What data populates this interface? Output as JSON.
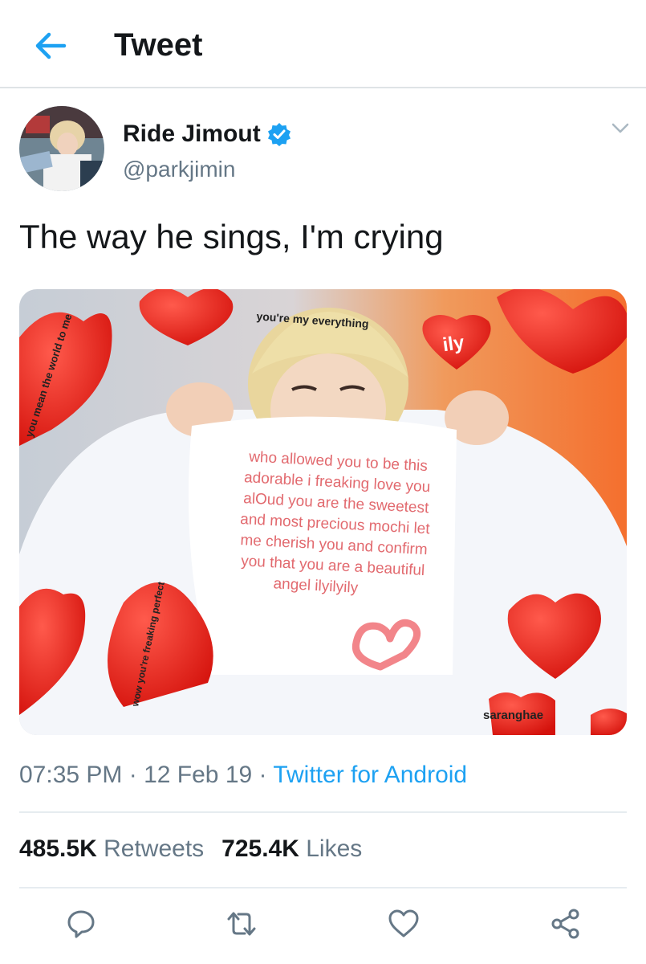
{
  "header": {
    "title": "Tweet",
    "back_icon": "arrow-left-icon"
  },
  "tweet": {
    "display_name": "Ride Jimout",
    "handle": "@parkjimin",
    "verified_icon": "verified-badge-icon",
    "menu_icon": "chevron-down-icon",
    "text": "The way he sings, I'm crying",
    "media": {
      "top_caption": "you're my everything",
      "left_caption": "you mean the world to me",
      "heart_label_ily": "ily",
      "bottom_left_caption": "wow you're freaking perfect",
      "bottom_right_caption": "saranghae",
      "sign_lines": [
        "who allowed you to be this",
        "adorable i freaking love you",
        "alOud you are the sweetest",
        "and most precious mochi let",
        "me cherish you and confirm",
        "you that you are a beautiful",
        "angel ilyilyily"
      ]
    },
    "time": "07:35 PM",
    "date": "12 Feb 19",
    "source": "Twitter for Android",
    "retweets_count": "485.5K",
    "retweets_label": "Retweets",
    "likes_count": "725.4K",
    "likes_label": "Likes"
  },
  "actions": {
    "reply_icon": "reply-icon",
    "retweet_icon": "retweet-icon",
    "like_icon": "heart-icon",
    "share_icon": "share-icon"
  },
  "colors": {
    "accent": "#1da1f2",
    "muted_text": "#657786",
    "primary_text": "#14171a",
    "divider": "#e6ecf0",
    "heart_red": "#e8201c"
  }
}
